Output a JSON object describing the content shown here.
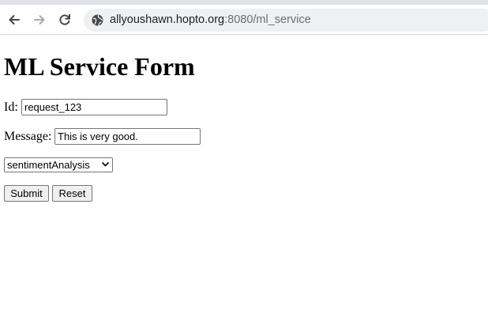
{
  "browser": {
    "url_host": "allyoushawn.hopto.org",
    "url_rest": ":8080/ml_service"
  },
  "page": {
    "title": "ML Service Form",
    "fields": {
      "id_label": "Id:",
      "id_value": "request_123",
      "message_label": "Message:",
      "message_value": "This is very good."
    },
    "service_select": {
      "selected": "sentimentAnalysis"
    },
    "buttons": {
      "submit": "Submit",
      "reset": "Reset"
    }
  }
}
